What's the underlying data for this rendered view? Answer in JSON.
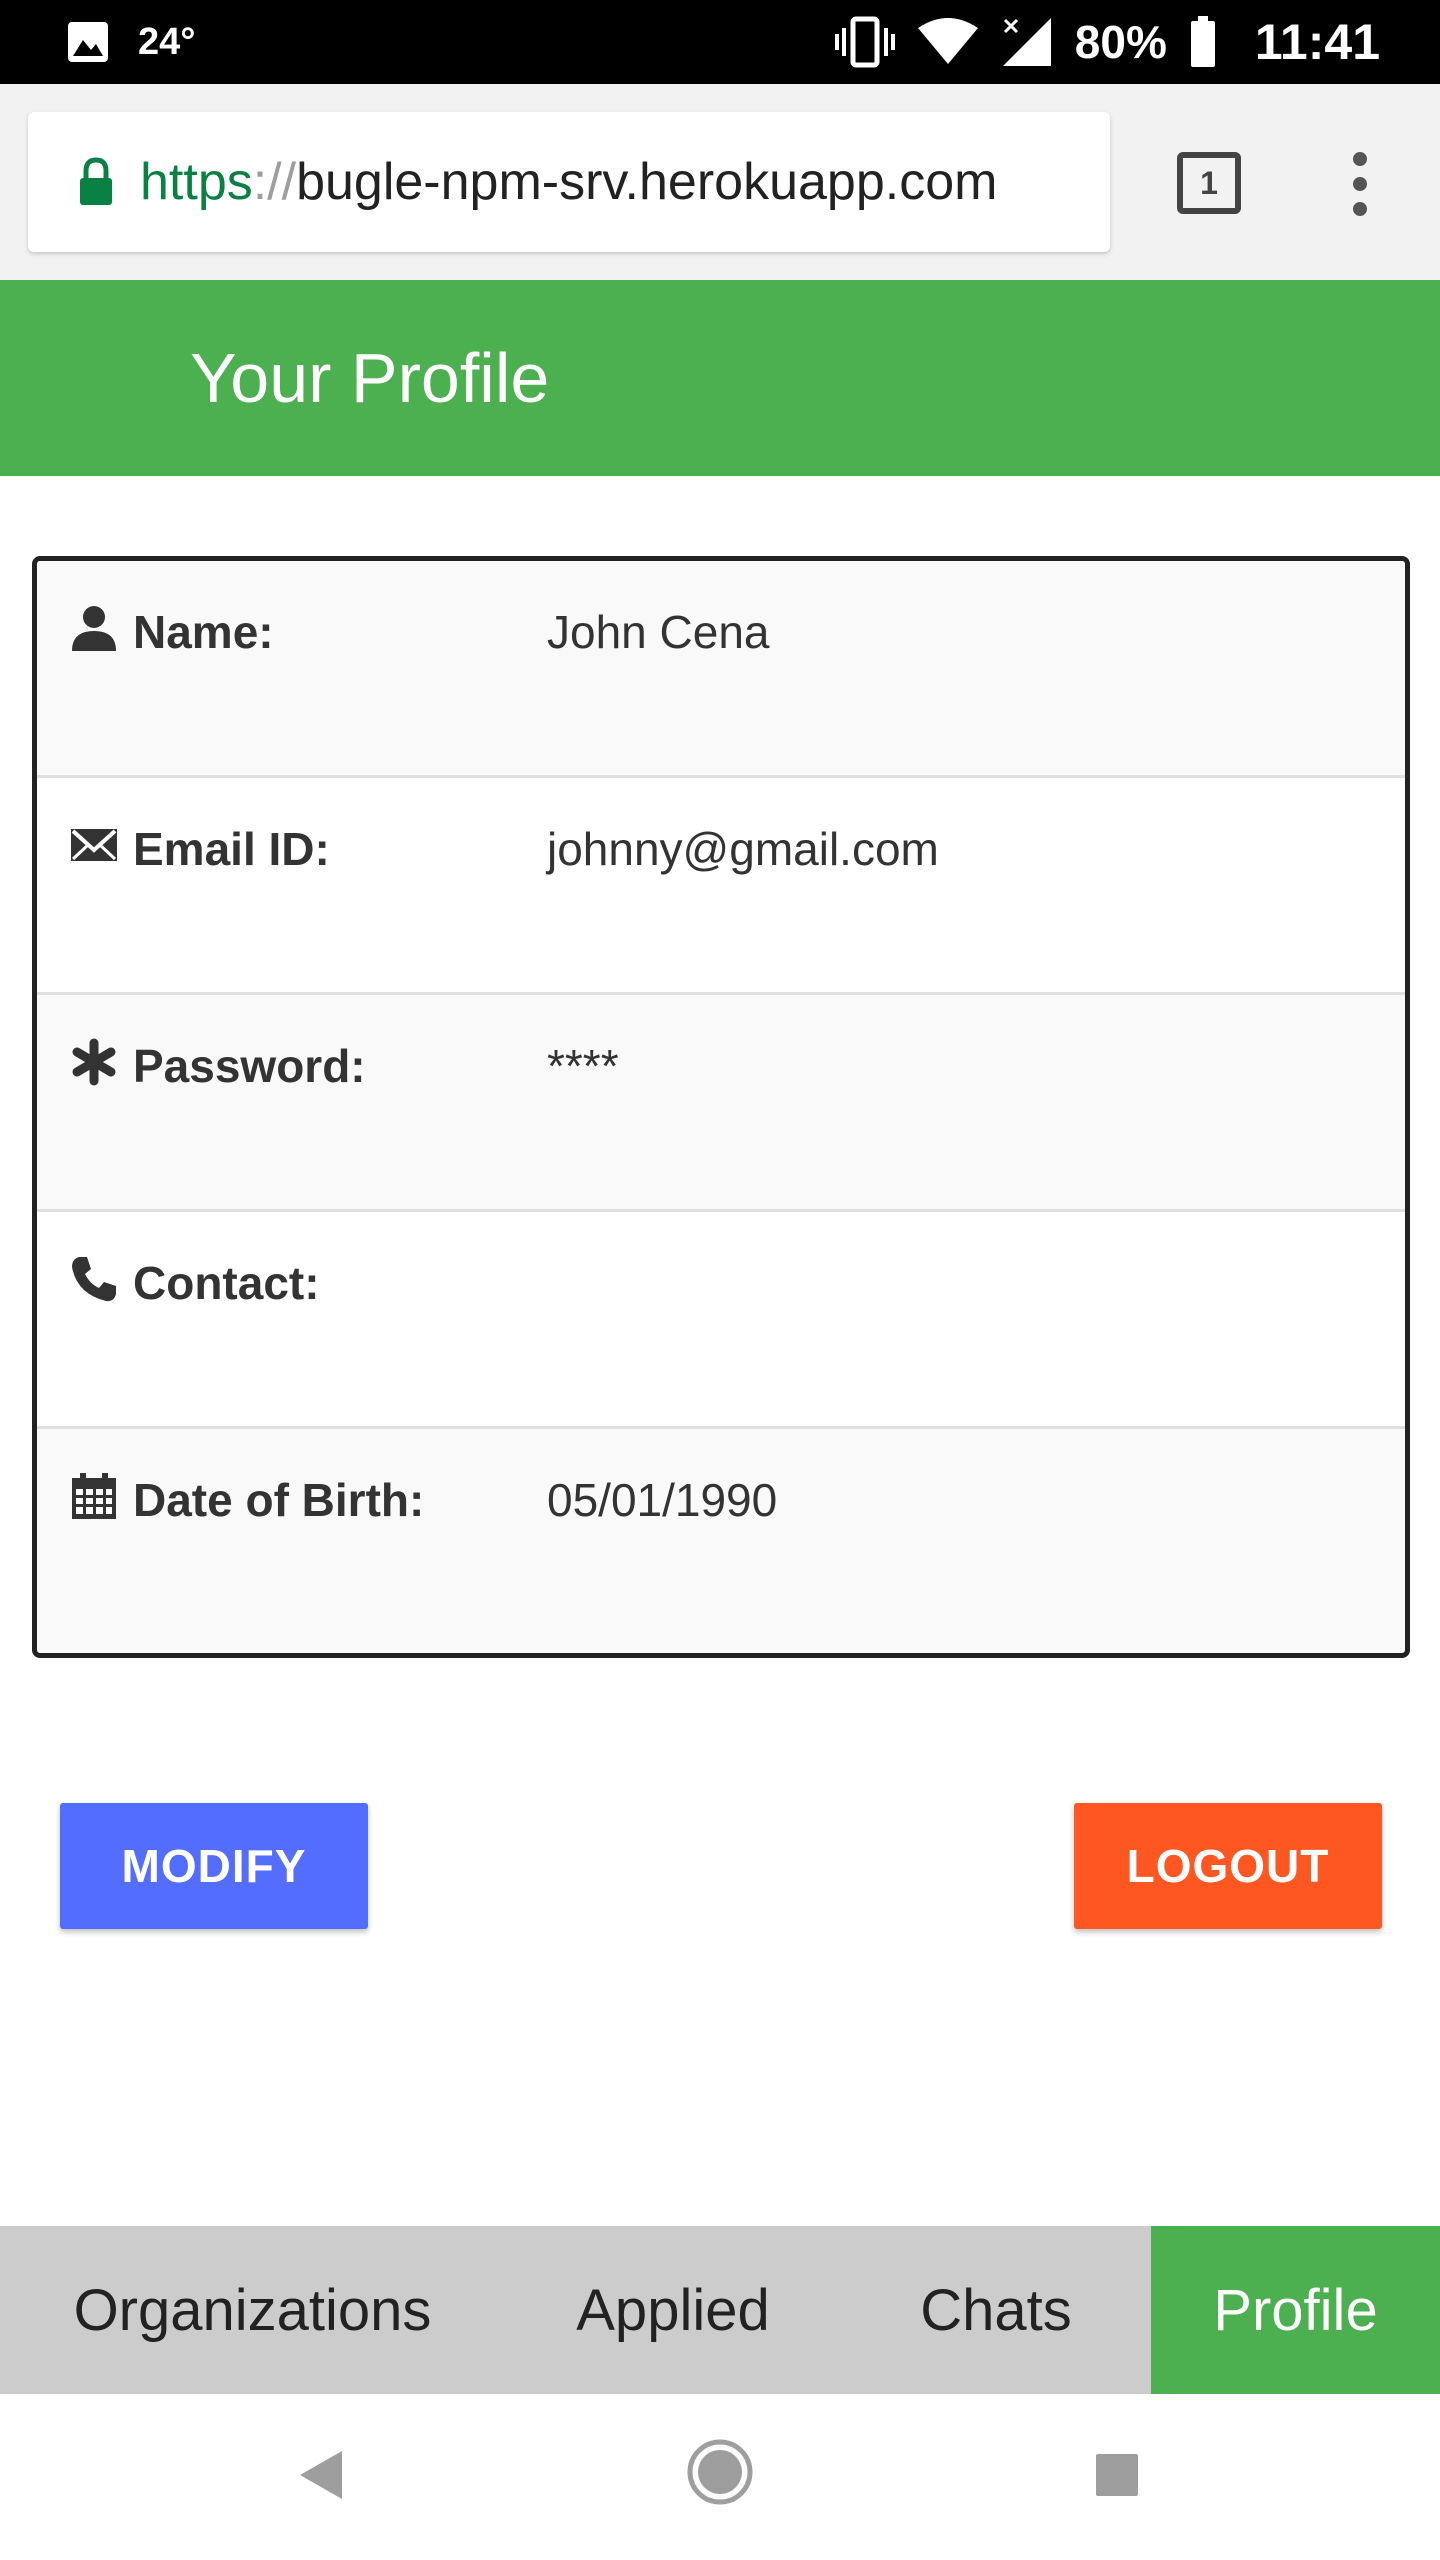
{
  "status_bar": {
    "temperature": "24°",
    "battery_percent": "80%",
    "time": "11:41"
  },
  "browser": {
    "url_scheme": "https",
    "url_separator": "://",
    "url_host": "bugle-npm-srv.herokuapp.com",
    "tab_count": "1"
  },
  "header": {
    "title": "Your Profile"
  },
  "profile": {
    "rows": [
      {
        "icon": "user-icon",
        "label": "Name:",
        "value": "John Cena"
      },
      {
        "icon": "envelope-icon",
        "label": "Email ID:",
        "value": "johnny@gmail.com"
      },
      {
        "icon": "asterisk-icon",
        "label": "Password:",
        "value": "****"
      },
      {
        "icon": "phone-icon",
        "label": "Contact:",
        "value": ""
      },
      {
        "icon": "calendar-icon",
        "label": "Date of Birth:",
        "value": "05/01/1990"
      }
    ]
  },
  "actions": {
    "modify_label": "MODIFY",
    "logout_label": "LOGOUT"
  },
  "bottom_nav": {
    "items": [
      {
        "label": "Organizations",
        "active": false
      },
      {
        "label": "Applied",
        "active": false
      },
      {
        "label": "Chats",
        "active": false
      },
      {
        "label": "Profile",
        "active": true
      }
    ]
  },
  "colors": {
    "header_green": "#4caf50",
    "modify_blue": "#536dfe",
    "logout_orange": "#ff5722",
    "nav_gray": "#cccccc"
  }
}
